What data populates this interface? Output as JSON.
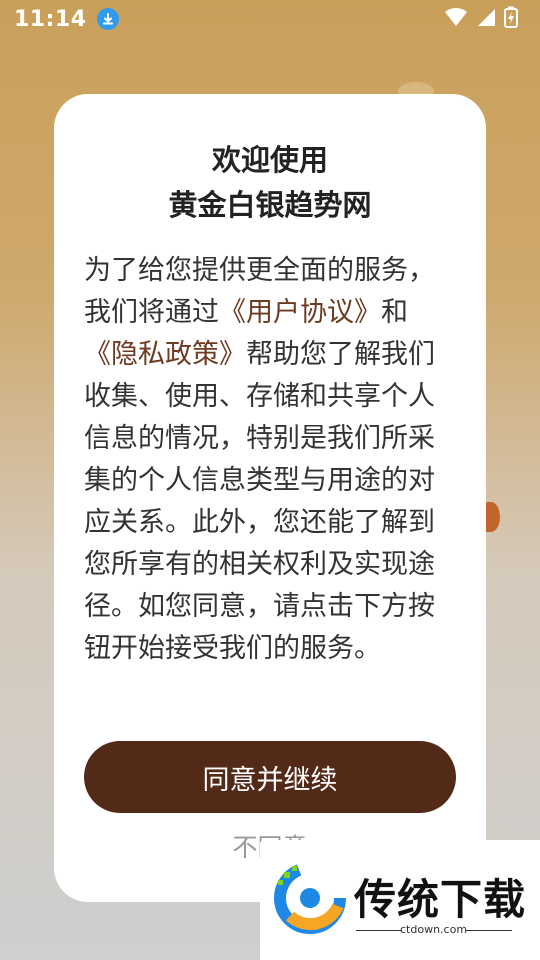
{
  "status_bar": {
    "time": "11:14",
    "download_icon": "download-icon",
    "wifi_icon": "wifi-icon",
    "signal_icon": "signal-icon",
    "battery_icon": "battery-charging-icon"
  },
  "dialog": {
    "title_line1": "欢迎使用",
    "title_line2": "黄金白银趋势网",
    "body_segments": [
      "为了给您提供更全面的服务，我们将通过",
      "《用户协议》",
      "和",
      "《隐私政策》",
      "帮助您了解我们收集、使用、存储和共享个人信息的情况，特别是我们所采集的个人信息类型与用途的对应关系。此外，您还能了解到您所享有的相关权利及实现途径。如您同意，请点击下方按钮开始接受我们的服务。"
    ],
    "agree_label": "同意并继续",
    "disagree_label": "不同意",
    "accent_color": "#532a17",
    "link_color": "#6e3a20"
  },
  "watermark": {
    "title": "传统下载",
    "url": "ctdown.com"
  }
}
